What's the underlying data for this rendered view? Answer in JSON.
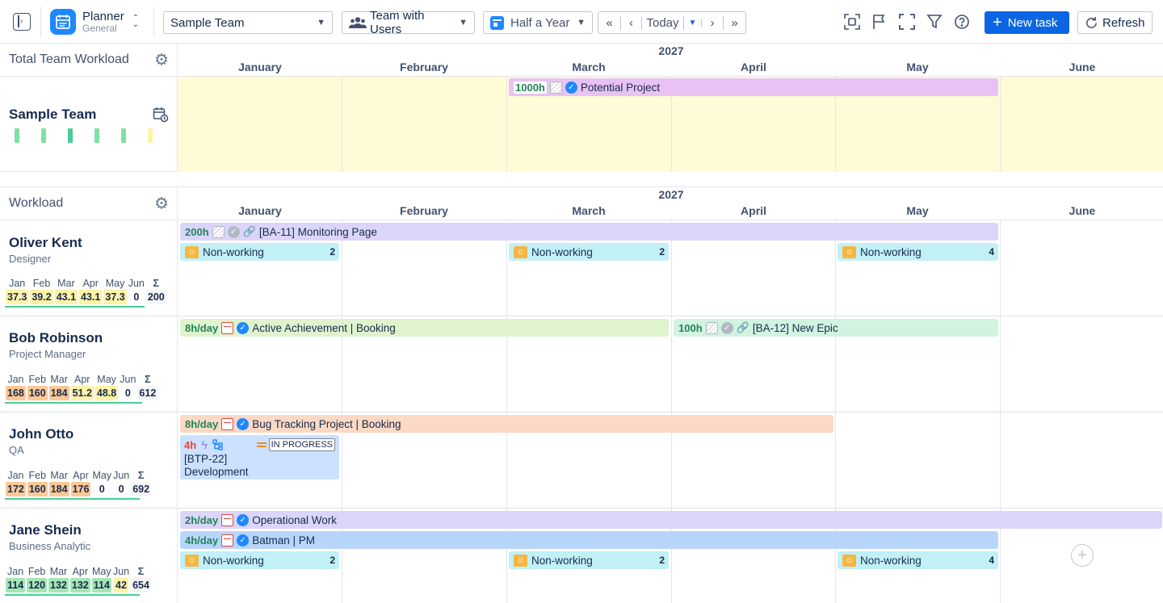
{
  "toolbar": {
    "app_name": "Planner",
    "app_sub": "General",
    "team_select": "Sample Team",
    "view_select": "Team with Users",
    "period_select": "Half a Year",
    "today_label": "Today",
    "new_task_label": "New task",
    "refresh_label": "Refresh"
  },
  "calendar": {
    "year": "2027",
    "months": [
      "January",
      "February",
      "March",
      "April",
      "May",
      "June"
    ]
  },
  "team_section": {
    "header": "Total Team Workload",
    "team_name": "Sample Team",
    "bar": {
      "hours": "1000h",
      "label": "Potential Project"
    }
  },
  "workload_section": {
    "header": "Workload",
    "sigma": "Σ",
    "month_abbr": [
      "Jan",
      "Feb",
      "Mar",
      "Apr",
      "May",
      "Jun"
    ],
    "non_working_label": "Non-working",
    "people": [
      {
        "name": "Oliver Kent",
        "role": "Designer",
        "values": [
          "37.3",
          "39.2",
          "43.1",
          "43.1",
          "37.3",
          "0"
        ],
        "total": "200",
        "bars": [
          {
            "hours": "200h",
            "label": "[BA-11] Monitoring Page"
          }
        ],
        "nonworking": [
          "2",
          "2",
          "4"
        ]
      },
      {
        "name": "Bob Robinson",
        "role": "Project Manager",
        "values": [
          "168",
          "160",
          "184",
          "51.2",
          "48.8",
          "0"
        ],
        "total": "612",
        "bars": [
          {
            "hours": "8h/day",
            "label": "Active Achievement | Booking"
          },
          {
            "hours": "100h",
            "label": "[BA-12] New Epic"
          }
        ]
      },
      {
        "name": "John Otto",
        "role": "QA",
        "values": [
          "172",
          "160",
          "184",
          "176",
          "0",
          "0"
        ],
        "total": "692",
        "bars": [
          {
            "hours": "8h/day",
            "label": "Bug Tracking Project | Booking"
          }
        ],
        "task": {
          "hours": "4h",
          "status": "IN PROGRESS",
          "key": "[BTP-22]",
          "title": "Development"
        }
      },
      {
        "name": "Jane Shein",
        "role": "Business Analytic",
        "values": [
          "114",
          "120",
          "132",
          "132",
          "114",
          "42"
        ],
        "total": "654",
        "bars": [
          {
            "hours": "2h/day",
            "label": "Operational Work"
          },
          {
            "hours": "4h/day",
            "label": "Batman | PM"
          }
        ],
        "nonworking": [
          "2",
          "2",
          "4"
        ]
      }
    ]
  },
  "colors": {
    "accent": "#0c66e4",
    "team_bg": "#fefbd6",
    "potential_project": "#e8c2f4",
    "low": "#fef2a6",
    "mid": "#fbc896",
    "high": "#a5e6b5"
  }
}
